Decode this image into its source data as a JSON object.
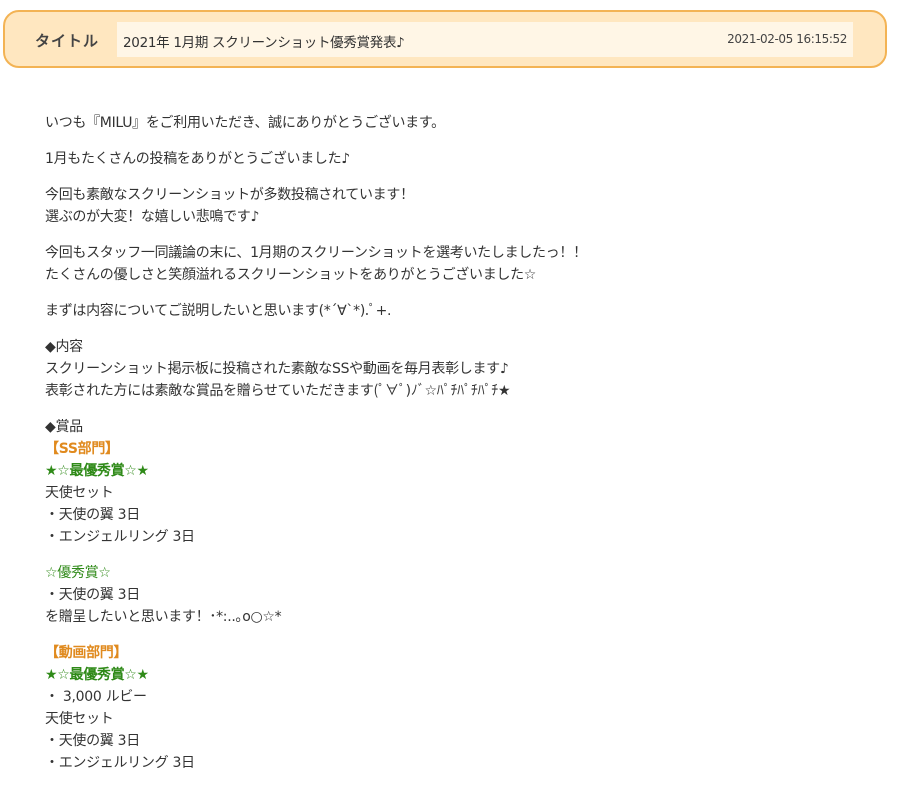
{
  "header": {
    "label": "タイトル",
    "title": "2021年 1月期 スクリーンショット優秀賞発表♪",
    "date": "2021-02-05 16:15:52"
  },
  "body": {
    "p1": "いつも『MILU』をご利用いただき、誠にありがとうございます。",
    "p2": "1月もたくさんの投稿をありがとうございました♪",
    "p3": [
      "今回も素敵なスクリーンショットが多数投稿されています！",
      "選ぶのが大変！な嬉しい悲鳴です♪"
    ],
    "p4": [
      "今回もスタッフ一同議論の末に、1月期のスクリーンショットを選考いたしましたっ！！",
      "たくさんの優しさと笑顔溢れるスクリーンショットをありがとうございました☆"
    ],
    "p5": "まずは内容についてご説明したいと思います(*´∀`*).ﾟ+.",
    "naiyou": {
      "heading": "◆内容",
      "lines": [
        "スクリーンショット掲示板に投稿された素敵なSSや動画を毎月表彰します♪",
        "表彰された方には素敵な賞品を贈らせていただきます(ﾟ∀ﾟ)ﾉﾞ☆ﾊﾟﾁﾊﾟﾁﾊﾟﾁ★"
      ]
    },
    "shouhin": {
      "heading": "◆賞品",
      "ss_dept": "【SS部門】",
      "ss_top_award": "★☆最優秀賞☆★",
      "ss_top_items": [
        "天使セット",
        "・天使の翼 3日",
        "・エンジェルリング 3日"
      ],
      "ss_excellent_award": "☆優秀賞☆",
      "ss_excellent_items": [
        "・天使の翼 3日",
        "を贈呈したいと思います！･*:..｡o○☆*"
      ],
      "video_dept": "【動画部門】",
      "video_top_award": "★☆最優秀賞☆★",
      "video_top_items": [
        "・ 3,000 ルビー",
        "天使セット",
        "・天使の翼 3日",
        "・エンジェルリング 3日"
      ]
    }
  }
}
